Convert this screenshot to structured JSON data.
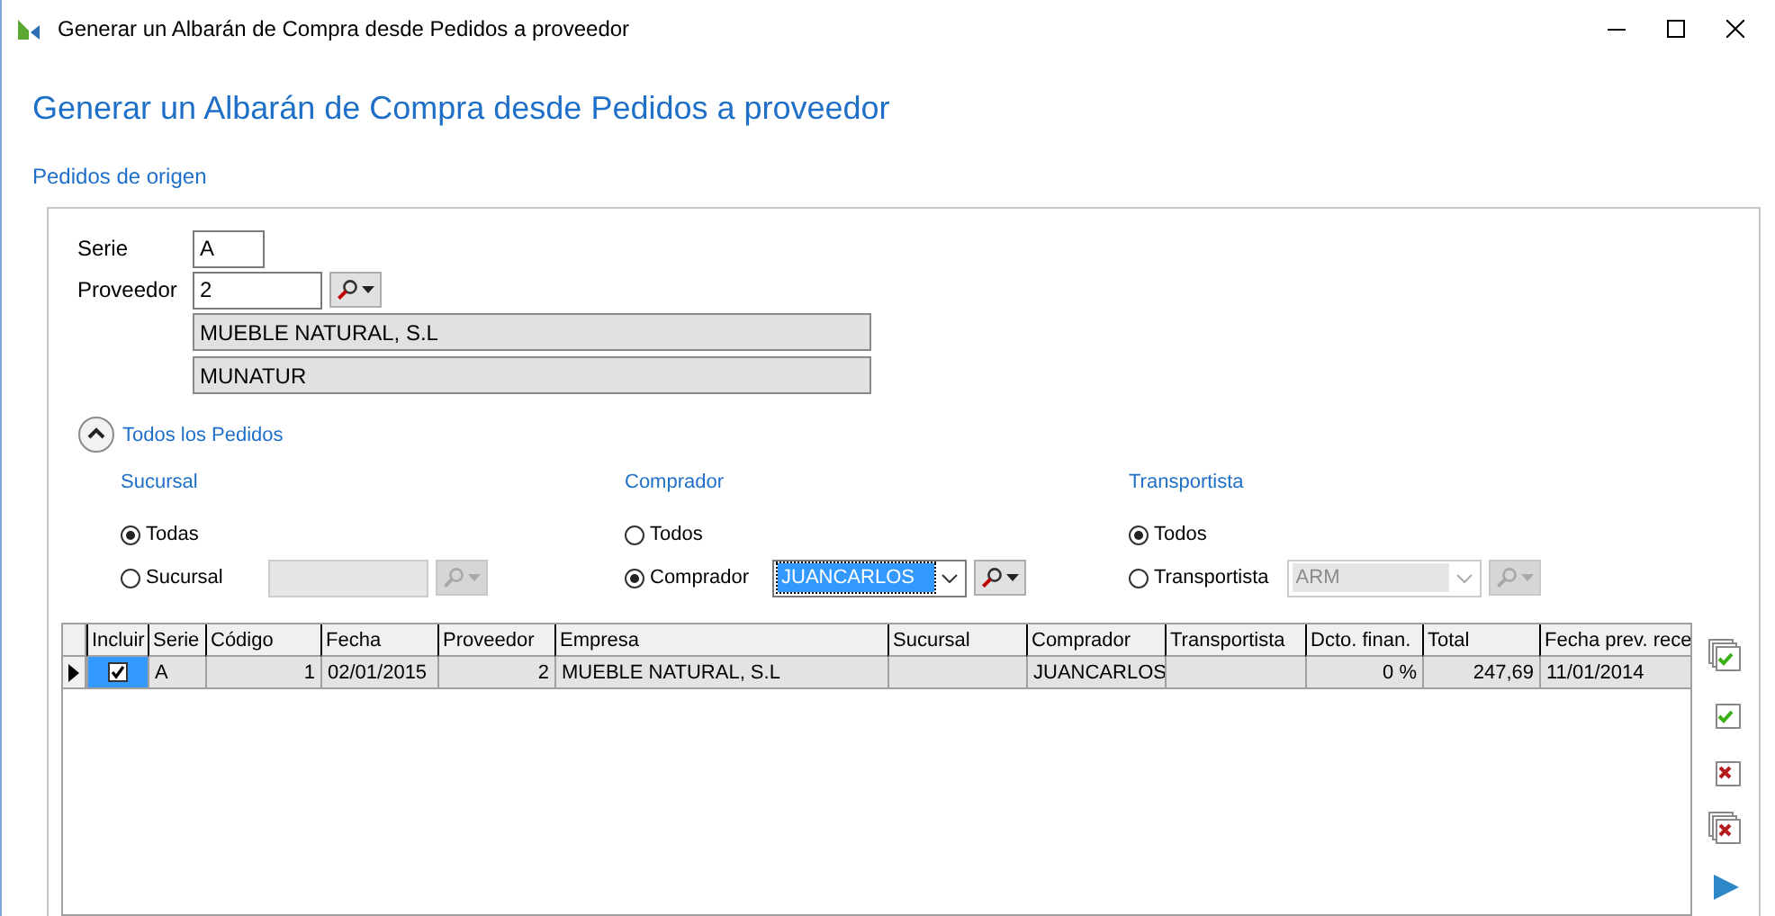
{
  "window": {
    "title": "Generar un Albarán de Compra desde Pedidos a proveedor"
  },
  "heading": "Generar un Albarán de Compra desde Pedidos a proveedor",
  "section_title": "Pedidos de origen",
  "fields": [
    {
      "label": "Serie",
      "value": "A",
      "kind": "short"
    },
    {
      "label": "Proveedor",
      "value": "2",
      "kind": "lookup"
    }
  ],
  "supplier_name": "MUEBLE NATURAL, S.L",
  "supplier_alias": "MUNATUR",
  "filter": {
    "label": "Todos los Pedidos",
    "expanded": true,
    "groups": [
      {
        "title": "Sucursal",
        "options": [
          {
            "label": "Todas",
            "selected": true
          },
          {
            "label": "Sucursal",
            "selected": false
          }
        ],
        "field": {
          "kind": "text",
          "disabled": true
        }
      },
      {
        "title": "Comprador",
        "options": [
          {
            "label": "Todos",
            "selected": false
          },
          {
            "label": "Comprador",
            "selected": true
          }
        ],
        "field": {
          "kind": "combo",
          "value": "JUANCARLOS",
          "disabled": false,
          "focused": true
        }
      },
      {
        "title": "Transportista",
        "options": [
          {
            "label": "Todos",
            "selected": true
          },
          {
            "label": "Transportista",
            "selected": false
          }
        ],
        "field": {
          "kind": "combo",
          "value": "ARM",
          "disabled": true,
          "focused": false
        }
      }
    ]
  },
  "grid": {
    "columns": [
      {
        "label": "Incluir",
        "kind": "check"
      },
      {
        "label": "Serie",
        "kind": "text"
      },
      {
        "label": "Código",
        "kind": "number"
      },
      {
        "label": "Fecha",
        "kind": "text"
      },
      {
        "label": "Proveedor",
        "kind": "number"
      },
      {
        "label": "Empresa",
        "kind": "text"
      },
      {
        "label": "Sucursal",
        "kind": "text"
      },
      {
        "label": "Comprador",
        "kind": "text"
      },
      {
        "label": "Transportista",
        "kind": "text"
      },
      {
        "label": "Dcto. finan.",
        "kind": "number"
      },
      {
        "label": "Total",
        "kind": "number"
      },
      {
        "label": "Fecha prev. rece",
        "kind": "text"
      }
    ],
    "rows": [
      {
        "current": true,
        "cells": [
          {
            "checked": true,
            "focused": true
          },
          {
            "text": "A"
          },
          {
            "text": "1"
          },
          {
            "text": "02/01/2015"
          },
          {
            "text": "2"
          },
          {
            "text": "MUEBLE NATURAL, S.L"
          },
          {},
          {
            "text": "JUANCARLOS"
          },
          {},
          {
            "text": "0 %"
          },
          {
            "text": "247,69"
          },
          {
            "text": "11/01/2014"
          }
        ]
      }
    ]
  }
}
